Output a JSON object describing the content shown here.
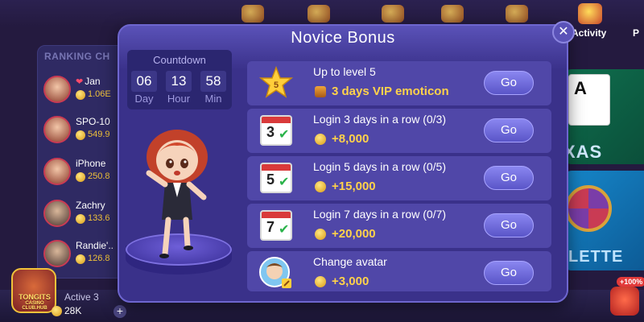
{
  "lobby": {
    "activity_label": "Activity",
    "p_label": "P",
    "ranking_title": "RANKING CH",
    "ranking": [
      {
        "name": "Jan",
        "score": "1.06E",
        "heart": "❤"
      },
      {
        "name": "SPO-10",
        "score": "549.9"
      },
      {
        "name": "iPhone",
        "score": "250.8"
      },
      {
        "name": "Zachry",
        "score": "133.6"
      },
      {
        "name": "Randie'..",
        "score": "126.8"
      }
    ],
    "texas_label": "XAS",
    "roulette_label": "LETTE",
    "ace": "A",
    "active_label": "Active 3",
    "active_value": "28K",
    "plus": "+",
    "cart_badge": "+100%",
    "logo_text": "TONGITS",
    "logo_sub": "CASINO",
    "logo_sub2": "CLUB.HUB"
  },
  "modal": {
    "title": "Novice Bonus",
    "close": "✕",
    "countdown": {
      "label": "Countdown",
      "day": "06",
      "hour": "13",
      "min": "58",
      "day_label": "Day",
      "hour_label": "Hour",
      "min_label": "Min"
    },
    "tasks": [
      {
        "title": "Up to level 5",
        "reward": "3 days VIP emoticon",
        "button": "Go",
        "icon": "star-level-icon",
        "star_text": "5"
      },
      {
        "title": "Login 3 days in a row (0/3)",
        "reward": "+8,000",
        "button": "Go",
        "icon": "calendar-icon",
        "day": "3"
      },
      {
        "title": "Login 5 days in a row (0/5)",
        "reward": "+15,000",
        "button": "Go",
        "icon": "calendar-icon",
        "day": "5"
      },
      {
        "title": "Login 7 days in a row (0/7)",
        "reward": "+20,000",
        "button": "Go",
        "icon": "calendar-icon",
        "day": "7"
      },
      {
        "title": "Change avatar",
        "reward": "+3,000",
        "button": "Go",
        "icon": "avatar-icon"
      }
    ],
    "colors": {
      "panel": "#3a318a",
      "row": "#5047a8",
      "button": "#6f6ae0",
      "reward": "#ffd24a"
    }
  }
}
